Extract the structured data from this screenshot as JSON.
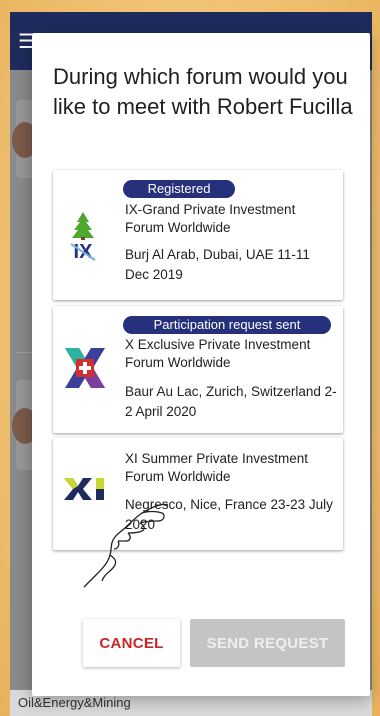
{
  "dialog": {
    "title": "During which forum would you like to meet with Robert Fucilla",
    "forums": [
      {
        "badge": "Registered",
        "name": "IX-Grand Private Investment Forum Worldwide",
        "venue": "Burj Al Arab, Dubai, UAE 11-11 Dec 2019",
        "logo_icon": "ix-forum-logo-icon"
      },
      {
        "badge": "Participation request sent",
        "name": "X Exclusive Private Investment Forum Worldwide",
        "venue": "Baur Au Lac, Zurich, Switzerland 2-2 April 2020",
        "logo_icon": "x-forum-logo-icon"
      },
      {
        "badge": "",
        "name": "XI Summer Private Investment Forum Worldwide",
        "venue": "Negresco, Nice, France 23-23 July 2020",
        "logo_icon": "xi-forum-logo-icon"
      }
    ],
    "cancel_label": "CANCEL",
    "send_label": "SEND REQUEST"
  },
  "background_app": {
    "footer_text": "Oil&Energy&Mining"
  },
  "colors": {
    "badge": "#27307a",
    "cancel_text": "#c62828",
    "send_disabled": "#c4c4c4",
    "topbar": "#1e2b5c",
    "page_background": "#f0c476"
  }
}
